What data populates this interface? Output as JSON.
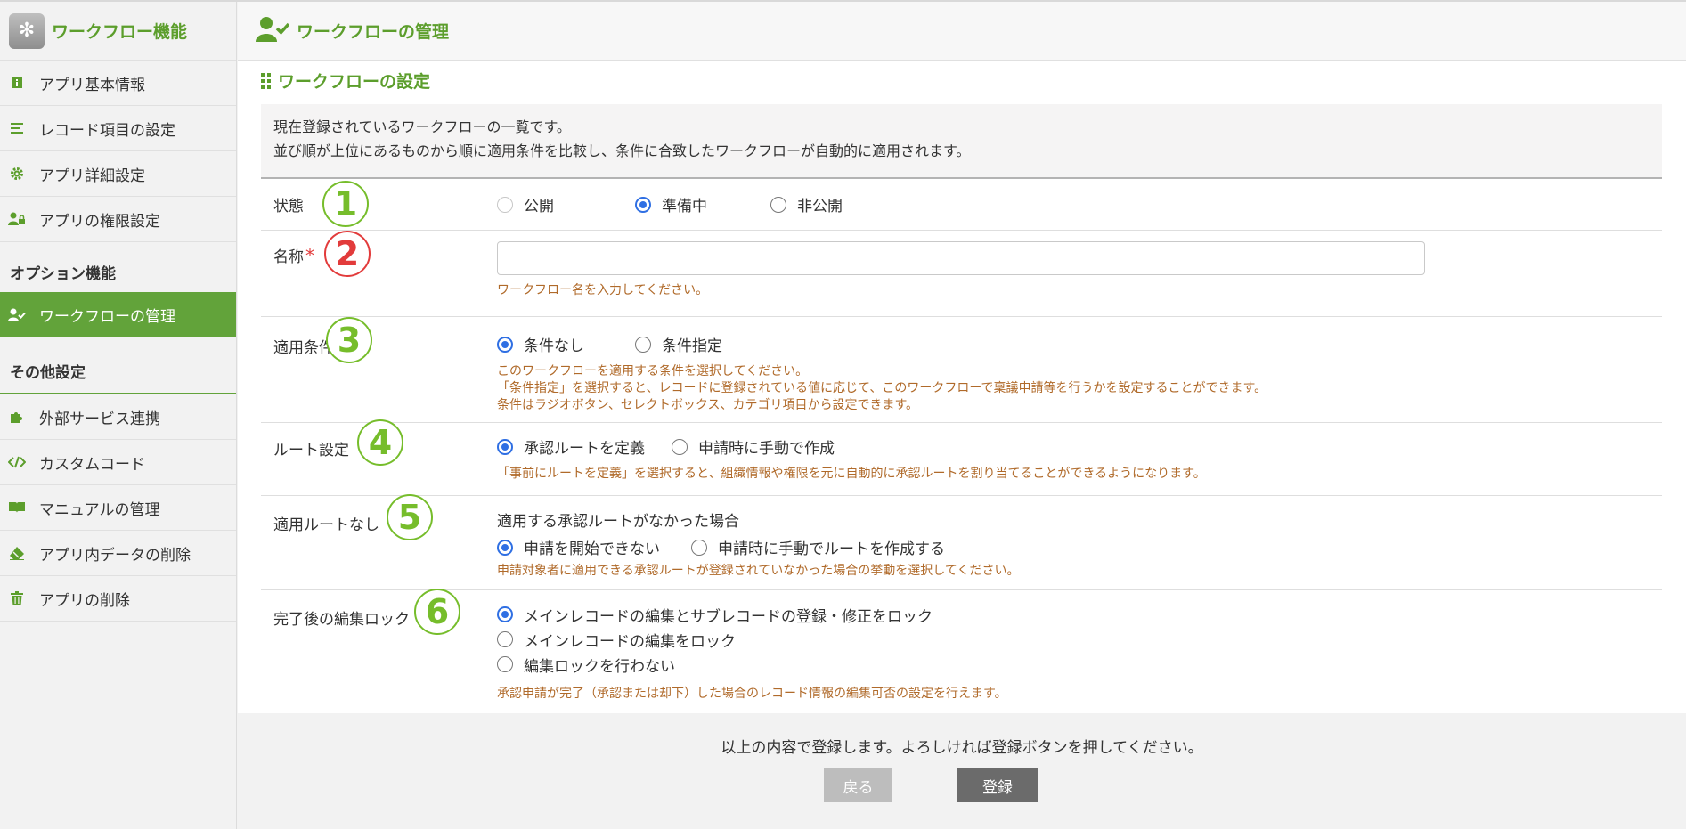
{
  "sidebar": {
    "app_title": "ワークフロー機能",
    "items_top": [
      {
        "label": "アプリ基本情報",
        "icon": "info-icon"
      },
      {
        "label": "レコード項目の設定",
        "icon": "list-icon"
      },
      {
        "label": "アプリ詳細設定",
        "icon": "gear-icon"
      },
      {
        "label": "アプリの権限設定",
        "icon": "user-lock-icon"
      }
    ],
    "section_option": "オプション機能",
    "workflow_item": "ワークフローの管理",
    "section_other": "その他設定",
    "items_other": [
      {
        "label": "外部サービス連携",
        "icon": "puzzle-icon"
      },
      {
        "label": "カスタムコード",
        "icon": "code-icon"
      },
      {
        "label": "マニュアルの管理",
        "icon": "book-icon"
      },
      {
        "label": "アプリ内データの削除",
        "icon": "eraser-icon"
      },
      {
        "label": "アプリの削除",
        "icon": "trash-icon"
      }
    ]
  },
  "header": {
    "title": "ワークフローの管理"
  },
  "section": {
    "title": "ワークフローの設定"
  },
  "description": {
    "line1": "現在登録されているワークフローの一覧です。",
    "line2": "並び順が上位にあるものから順に適用条件を比較し、条件に合致したワークフローが自動的に適用されます。"
  },
  "markers": {
    "m1": "1",
    "m2": "2",
    "m3": "3",
    "m4": "4",
    "m5": "5",
    "m6": "6"
  },
  "form": {
    "status": {
      "label": "状態",
      "options": [
        "公開",
        "準備中",
        "非公開"
      ],
      "selected": "準備中"
    },
    "name": {
      "label": "名称",
      "required_mark": "*",
      "value": "",
      "hint": "ワークフロー名を入力してください。"
    },
    "condition": {
      "label": "適用条件",
      "options": [
        "条件なし",
        "条件指定"
      ],
      "selected": "条件なし",
      "hint1": "このワークフローを適用する条件を選択してください。",
      "hint2": "「条件指定」を選択すると、レコードに登録されている値に応じて、このワークフローで稟議申請等を行うかを設定することができます。",
      "hint3": "条件はラジオボタン、セレクトボックス、カテゴリ項目から設定できます。"
    },
    "route": {
      "label": "ルート設定",
      "options": [
        "承認ルートを定義",
        "申請時に手動で作成"
      ],
      "selected": "承認ルートを定義",
      "hint": "「事前にルートを定義」を選択すると、組織情報や権限を元に自動的に承認ルートを割り当てることができるようになります。"
    },
    "no_route": {
      "label": "適用ルートなし",
      "caption": "適用する承認ルートがなかった場合",
      "options": [
        "申請を開始できない",
        "申請時に手動でルートを作成する"
      ],
      "selected": "申請を開始できない",
      "hint": "申請対象者に適用できる承認ルートが登録されていなかった場合の挙動を選択してください。"
    },
    "lock": {
      "label": "完了後の編集ロック",
      "options": [
        "メインレコードの編集とサブレコードの登録・修正をロック",
        "メインレコードの編集をロック",
        "編集ロックを行わない"
      ],
      "selected": "メインレコードの編集とサブレコードの登録・修正をロック",
      "hint": "承認申請が完了（承認または却下）した場合のレコード情報の編集可否の設定を行えます。"
    }
  },
  "footer": {
    "message": "以上の内容で登録します。よろしければ登録ボタンを押してください。",
    "back_label": "戻る",
    "submit_label": "登録"
  }
}
